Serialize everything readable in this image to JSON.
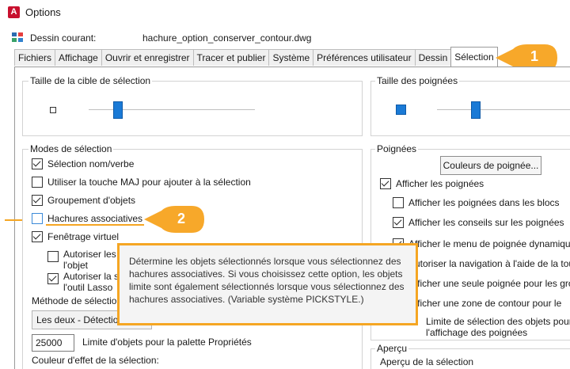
{
  "window": {
    "title": "Options",
    "app_icon_letter": "A"
  },
  "drawing": {
    "label": "Dessin courant:",
    "file": "hachure_option_conserver_contour.dwg"
  },
  "tabs": [
    {
      "label": "Fichiers"
    },
    {
      "label": "Affichage"
    },
    {
      "label": "Ouvrir et enregistrer"
    },
    {
      "label": "Tracer et publier"
    },
    {
      "label": "Système"
    },
    {
      "label": "Préférences utilisateur"
    },
    {
      "label": "Dessin"
    },
    {
      "label": "Sélection"
    }
  ],
  "pickbox": {
    "label": "Taille de la cible de sélection",
    "level": 0.12
  },
  "grip_size": {
    "label": "Taille des poignées",
    "level": 0.22
  },
  "selection_modes": {
    "label": "Modes de sélection",
    "noun_verb": "Sélection nom/verbe",
    "shift_add": "Utiliser la touche MAJ pour ajouter à la sélection",
    "object_grouping": "Groupement d'objets",
    "assoc_hatch": "Hachures associatives",
    "implied_window": "Fenêtrage virtuel",
    "allow_press_drag_a": "Autoriser les a",
    "allow_press_drag_b": "l'objet",
    "allow_lasso_a": "Autoriser la se",
    "allow_lasso_b": "l'outil Lasso",
    "window_method_label": "Méthode de sélection",
    "window_method_value": "Les deux - Détection",
    "object_limit_value": "25000",
    "object_limit_label": "Limite d'objets pour la palette Propriétés",
    "effect_color_label": "Couleur d'effet de la sélection:"
  },
  "grips": {
    "label": "Poignées",
    "colors_button": "Couleurs de poignée...",
    "show_grips": "Afficher les poignées",
    "grips_in_blocks": "Afficher les poignées dans les blocs",
    "grip_tips": "Afficher les conseils sur les poignées",
    "dynamic_menu": "Afficher le menu de poignée dynamique",
    "ctrl_cycle": "Autoriser la navigation à l'aide de la touc",
    "single_grip": "Afficher une seule poignée pour les grou",
    "bounding_box": "Afficher une zone de contour pour le",
    "object_limit_a": "Limite de sélection des objets pour",
    "object_limit_b": "l'affichage des poignées"
  },
  "preview": {
    "label": "Aperçu",
    "sub_label": "Aperçu de la sélection"
  },
  "tooltip": {
    "text": "Détermine les objets sélectionnés lorsque vous sélectionnez des hachures associatives. Si vous choisissez cette option, les objets limite sont également sélectionnés lorsque vous sélectionnez des hachures associatives. (Variable système PICKSTYLE.)"
  },
  "callouts": {
    "one": "1",
    "two": "2"
  },
  "colors": {
    "accent": "#f5a623",
    "slider": "#1a7ad6",
    "grip_box": "#1a7ad6"
  }
}
